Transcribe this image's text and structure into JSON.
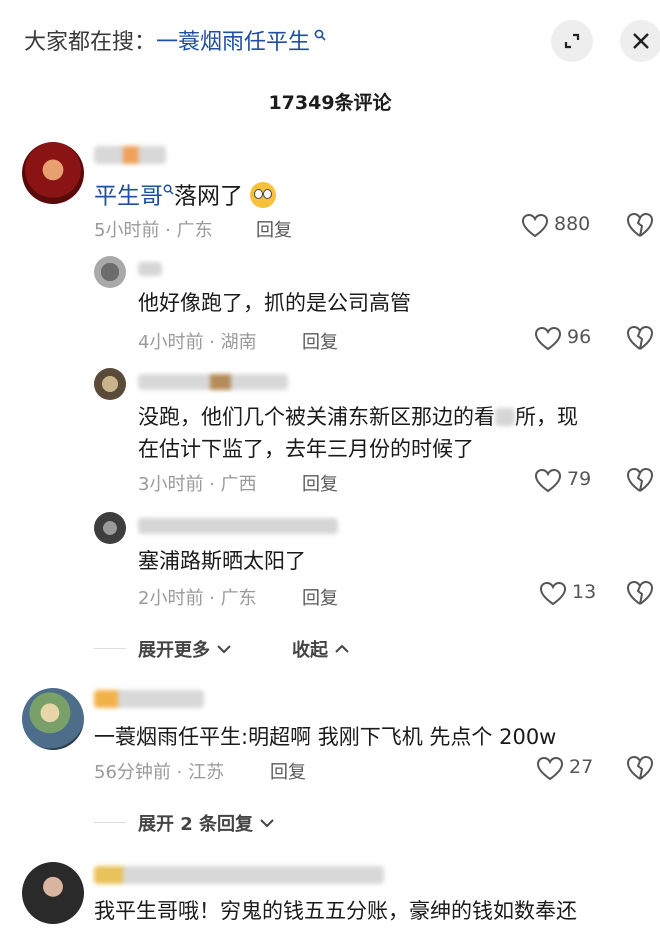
{
  "header": {
    "search_prefix": "大家都在搜：",
    "search_keyword": "一蓑烟雨任平生",
    "search_icon": "search-icon",
    "expand_icon": "expand-icon",
    "close_icon": "close-icon"
  },
  "comment_count": "17349条评论",
  "comments": [
    {
      "mention": "平生哥",
      "text": "落网了",
      "emoji": "astonished-face",
      "meta": "5小时前 · 广东",
      "reply": "回复",
      "likes": "880",
      "replies": [
        {
          "text": "他好像跑了，抓的是公司高管",
          "meta": "4小时前 · 湖南",
          "reply": "回复",
          "likes": "96"
        },
        {
          "text_line1": "没跑，他们几个被关浦东新区那边的看",
          "text_line1b": "所，现",
          "text_line2": "在估计下监了，去年三月份的时候了",
          "meta": "3小时前 · 广西",
          "reply": "回复",
          "likes": "79"
        },
        {
          "text": "塞浦路斯晒太阳了",
          "meta": "2小时前 · 广东",
          "reply": "回复",
          "likes": "13"
        }
      ],
      "expand_more": "展开更多",
      "collapse": "收起"
    },
    {
      "text": "一蓑烟雨任平生:明超啊 我刚下飞机 先点个 200w",
      "meta": "56分钟前 · 江苏",
      "reply": "回复",
      "likes": "27",
      "expand_replies": "展开 2 条回复"
    },
    {
      "text": "我平生哥哦！穷鬼的钱五五分账，豪绅的钱如数奉还"
    }
  ]
}
